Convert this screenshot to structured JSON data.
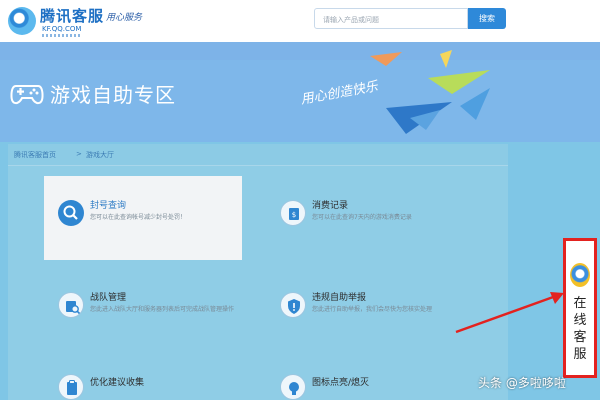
{
  "header": {
    "logo_main": "腾讯客服",
    "logo_sub": "KF.QQ.COM",
    "logo_script": "用心服务",
    "search_placeholder": "请输入产品或问题",
    "search_button": "搜索"
  },
  "banner": {
    "title": "游戏自助专区",
    "script_text": "用心创造快乐"
  },
  "breadcrumb": {
    "home": "腾讯客服首页",
    "separator": ">",
    "current": "游戏大厅"
  },
  "cards": [
    {
      "title": "封号查询",
      "desc": "您可以在此查询帐号减少封号处罚！",
      "icon": "search-icon"
    },
    {
      "title": "消费记录",
      "desc": "您可以在此查询7天内的游戏消费记录",
      "icon": "wallet-icon"
    },
    {
      "title": "战队管理",
      "desc": "您此进入战队大厅和服务器列表后可完成战队管理操作",
      "icon": "team-search-icon"
    },
    {
      "title": "违规自助举报",
      "desc": "您此进行自助举报，我们会尽快为您核实处理",
      "icon": "shield-icon"
    },
    {
      "title": "优化建议收集",
      "desc": "",
      "icon": "clipboard-icon"
    },
    {
      "title": "图标点亮/熄灭",
      "desc": "",
      "icon": "lightbulb-icon"
    }
  ],
  "online_service": {
    "label": "在线客服"
  },
  "watermark": "头条 @多啦哆啦",
  "colors": {
    "page_bg": "#7fc6e6",
    "banner_bg": "#7eb7ea",
    "accent_blue": "#2f86d1",
    "highlight_red": "#e3221f"
  }
}
